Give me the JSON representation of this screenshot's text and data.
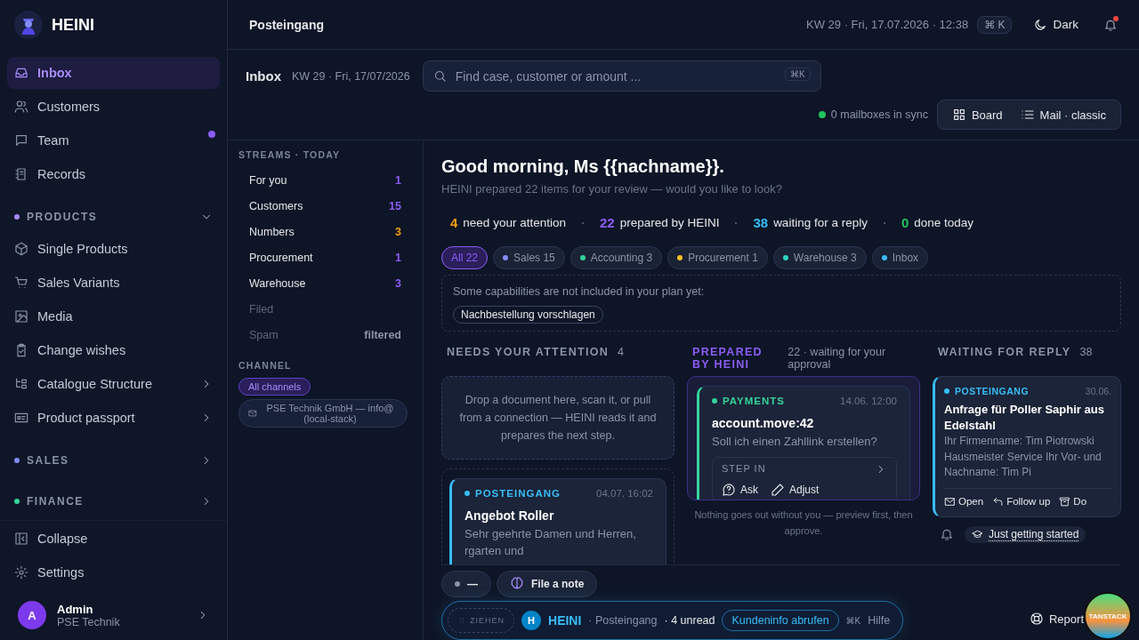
{
  "brand": {
    "name": "HEINI"
  },
  "nav": [
    {
      "label": "Inbox",
      "selected": true,
      "unread": false
    },
    {
      "label": "Customers",
      "selected": false,
      "unread": false
    },
    {
      "label": "Team",
      "selected": false,
      "unread": true
    },
    {
      "label": "Records",
      "selected": false,
      "unread": false
    }
  ],
  "sections": [
    {
      "title": "PRODUCTS",
      "color": "#a78bfa",
      "expanded": true,
      "items": [
        {
          "label": "Single Products",
          "has_children": false
        },
        {
          "label": "Sales Variants",
          "has_children": false
        },
        {
          "label": "Media",
          "has_children": false
        },
        {
          "label": "Change wishes",
          "has_children": false
        },
        {
          "label": "Catalogue Structure",
          "has_children": true
        },
        {
          "label": "Product passport",
          "has_children": true
        }
      ]
    },
    {
      "title": "SALES",
      "color": "#818cf8",
      "expanded": false
    },
    {
      "title": "FINANCE",
      "color": "#34d399",
      "expanded": false
    }
  ],
  "footer_nav": [
    {
      "label": "Collapse"
    },
    {
      "label": "Settings"
    }
  ],
  "user": {
    "initial": "A",
    "name": "Admin",
    "org": "PSE Technik"
  },
  "topbar": {
    "title": "Posteingang",
    "datetime": "KW 29 · Fri, 17.07.2026 · 12:38",
    "shortcut": "⌘ K",
    "theme": "Dark",
    "notification": true
  },
  "header": {
    "title": "Inbox",
    "date": "KW 29 · Fri, 17/07/2026",
    "search": {
      "placeholder": "Find case, customer or amount ...",
      "shortcut": "⌘K"
    },
    "sync": "0 mailboxes in sync",
    "views": [
      "Board",
      "Mail · classic"
    ]
  },
  "streams": {
    "title": "STREAMS · TODAY",
    "items": [
      {
        "label": "For you",
        "count": "1",
        "color": "#8b5cf6",
        "muted": false
      },
      {
        "label": "Customers",
        "count": "15",
        "color": "#8b5cf6",
        "muted": false
      },
      {
        "label": "Numbers",
        "count": "3",
        "color": "#f59e0b",
        "muted": false
      },
      {
        "label": "Procurement",
        "count": "1",
        "color": "#8b5cf6",
        "muted": false
      },
      {
        "label": "Warehouse",
        "count": "3",
        "color": "#8b5cf6",
        "muted": false
      },
      {
        "label": "Filed",
        "muted": true
      },
      {
        "label": "Spam",
        "count": "filtered",
        "muted": true
      }
    ]
  },
  "channel": {
    "title": "CHANNEL",
    "items": [
      {
        "label": "All channels",
        "selected": true
      },
      {
        "label": "PSE Technik GmbH — info@ (local-stack)",
        "selected": false
      }
    ]
  },
  "greeting": "Good morning, Ms {{nachname}}.",
  "subtitle": "HEINI prepared 22 items for your review — would you like to look?",
  "stats": [
    {
      "value": "4",
      "label": "need your attention",
      "color": "#f59e0b"
    },
    {
      "value": "22",
      "label": "prepared by HEINI",
      "color": "#8b5cf6"
    },
    {
      "value": "38",
      "label": "waiting for a reply",
      "color": "#38bdf8"
    },
    {
      "value": "0",
      "label": "done today",
      "color": "#22c55e"
    }
  ],
  "filters": [
    {
      "label": "All 22",
      "color": "#8b5cf6",
      "selected": true
    },
    {
      "label": "Sales 15",
      "color": "#818cf8",
      "selected": false
    },
    {
      "label": "Accounting 3",
      "color": "#34d399",
      "selected": false
    },
    {
      "label": "Procurement 1",
      "color": "#fbbf24",
      "selected": false
    },
    {
      "label": "Warehouse 3",
      "color": "#2dd4bf",
      "selected": false
    },
    {
      "label": "Inbox",
      "color": "#38bdf8",
      "selected": false
    }
  ],
  "capabilities": {
    "text": "Some capabilities are not included in your plan yet:",
    "tags": [
      "Nachbestellung vorschlagen"
    ]
  },
  "columns": [
    {
      "kind": "attention",
      "title": "NEEDS YOUR ATTENTION",
      "count": "4",
      "dropzone": "Drop a document here, scan it, or pull from a connection — HEINI reads it and prepares the next step.",
      "card": {
        "source": "POSTEINGANG",
        "color": "#38bdf8",
        "time": "04.07. 16:02",
        "title": "Angebot Roller",
        "preview": "Sehr geehrte Damen und Herren,",
        "preview_tail": "rgarten und"
      }
    },
    {
      "kind": "prepared",
      "title": "PREPARED BY HEINI",
      "count": "22 · waiting for your approval",
      "card": {
        "source": "PAYMENTS",
        "color": "#34d399",
        "time": "14.06. 12:00",
        "title": "account.move:42",
        "preview": "Soll ich einen Zahllink erstellen?",
        "step_in": {
          "label": "STEP IN",
          "expanded": false,
          "actions": [
            "Ask",
            "Adjust"
          ]
        }
      },
      "note": "Nothing goes out without you — preview first, then approve."
    },
    {
      "kind": "waiting",
      "title": "WAITING FOR REPLY",
      "count": "38",
      "card": {
        "source": "POSTEINGANG",
        "color": "#38bdf8",
        "time": "30.06.",
        "title": "Anfrage für Poller Saphir aus Edelstahl",
        "preview": "Ihr Firmenname: Tim Piotrowski Hausmeister Service Ihr Vor- und Nachname: Tim Pi",
        "actions": [
          "Open",
          "Follow up",
          "Do"
        ]
      }
    }
  ],
  "quick": {
    "status": "—",
    "note": "File a note"
  },
  "onboarding": "Just getting started",
  "assistant": {
    "handle": "ZIEHEN",
    "initial": "H",
    "name": "HEINI",
    "context": "· Posteingang",
    "unread": "· 4 unread",
    "action": "Kundeninfo abrufen",
    "shortcut": "⌘K",
    "help": "Hilfe"
  },
  "report": "Report",
  "devtools": "TANSTACK"
}
